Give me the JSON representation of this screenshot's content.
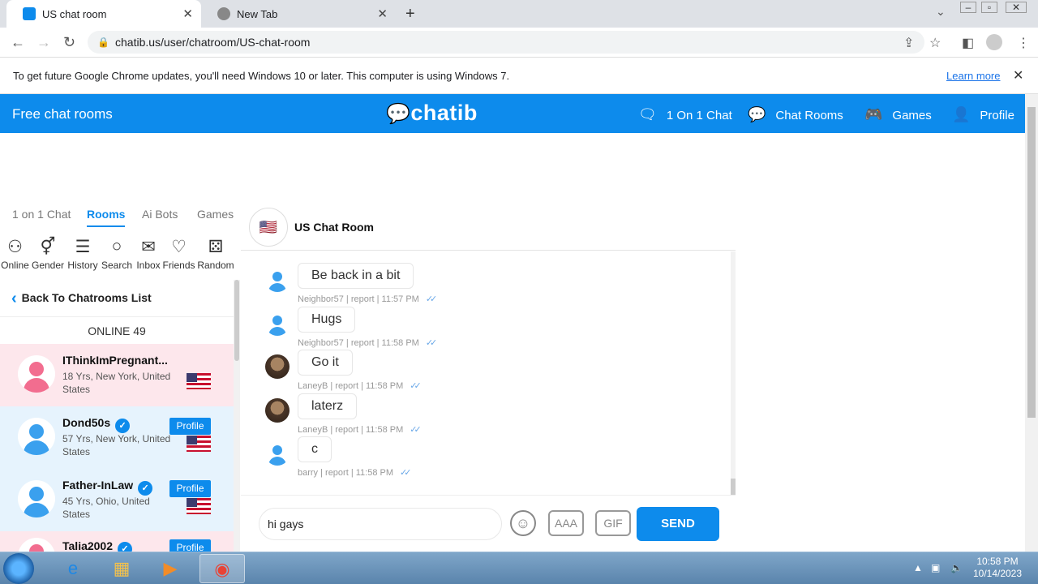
{
  "browser": {
    "tabs": [
      {
        "title": "US chat room",
        "active": true
      },
      {
        "title": "New Tab",
        "active": false
      }
    ],
    "url": "chatib.us/user/chatroom/US-chat-room",
    "infobar_text": "To get future Google Chrome updates, you'll need Windows 10 or later. This computer is using Windows 7.",
    "infobar_link": "Learn more"
  },
  "site": {
    "brand": "Free chat rooms",
    "logo": "chatib",
    "nav": [
      {
        "label": "1 On 1 Chat",
        "icon": "chat-bubble-icon"
      },
      {
        "label": "Chat Rooms",
        "icon": "chat-rooms-icon"
      },
      {
        "label": "Games",
        "icon": "gamepad-icon"
      },
      {
        "label": "Profile",
        "icon": "person-icon"
      }
    ],
    "accent": "#0d8bec"
  },
  "sidebar": {
    "tabs": [
      "1 on 1 Chat",
      "Rooms",
      "Ai Bots",
      "Games"
    ],
    "active_tab": "Rooms",
    "icons": [
      {
        "label": "Online",
        "icon": "online-user-icon"
      },
      {
        "label": "Gender",
        "icon": "gender-icon"
      },
      {
        "label": "History",
        "icon": "list-icon"
      },
      {
        "label": "Search",
        "icon": "search-icon"
      },
      {
        "label": "Inbox",
        "icon": "envelope-icon"
      },
      {
        "label": "Friends",
        "icon": "heart-icon"
      },
      {
        "label": "Random",
        "icon": "dice-icon"
      }
    ],
    "back_label": "Back To Chatrooms List",
    "online_label": "ONLINE 49",
    "users": [
      {
        "name": "IThinkImPregnant...",
        "meta": "18 Yrs, New York, United States",
        "verified": false,
        "profile_button": ""
      },
      {
        "name": "Dond50s",
        "meta": "57 Yrs, New York, United States",
        "verified": true,
        "profile_button": "Profile"
      },
      {
        "name": "Father-InLaw",
        "meta": "45 Yrs, Ohio, United States",
        "verified": true,
        "profile_button": "Profile"
      },
      {
        "name": "Talia2002",
        "meta": "",
        "verified": true,
        "profile_button": "Profile"
      }
    ]
  },
  "chat": {
    "room_title": "US Chat Room",
    "room_flag": "🇺🇸",
    "messages": [
      {
        "text": "Be back in a bit",
        "meta": "Neighbor57 | report | 11:57 PM",
        "avatar": "default"
      },
      {
        "text": "Hugs",
        "meta": "Neighbor57 | report | 11:58 PM",
        "avatar": "default"
      },
      {
        "text": "Go it",
        "meta": "LaneyB | report | 11:58 PM",
        "avatar": "photo"
      },
      {
        "text": "laterz",
        "meta": "LaneyB | report | 11:58 PM",
        "avatar": "photo"
      },
      {
        "text": "c",
        "meta": "barry | report | 11:58 PM",
        "avatar": "default"
      }
    ],
    "input_value": "hi gays",
    "format_button": "AAA",
    "gif_button": "GIF",
    "send_label": "SEND"
  },
  "taskbar": {
    "time": "10:58 PM",
    "date": "10/14/2023"
  }
}
